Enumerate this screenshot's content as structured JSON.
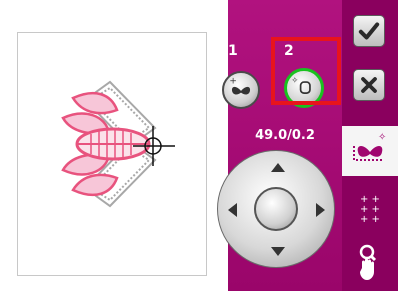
{
  "hoop": {
    "design_name_icon": "embroidery-design"
  },
  "position_buttons": [
    {
      "number": "1",
      "icon": "butterfly-move-icon"
    },
    {
      "number": "2",
      "icon": "corner-move-icon",
      "selected": true
    }
  ],
  "readout": {
    "value": "49.0/0.2"
  },
  "side_panel": {
    "confirm_icon": "checkmark-icon",
    "cancel_icon": "close-icon",
    "move_icon": "butterfly-move-icon",
    "grid_icon": "grid-plus-icon",
    "zoom_pan_icon": "zoom-pan-icon"
  },
  "colors": {
    "panel": "#a0066f",
    "panel_dark": "#8a005e",
    "highlight": "#e8141c",
    "selected_ring": "#19c21f"
  }
}
